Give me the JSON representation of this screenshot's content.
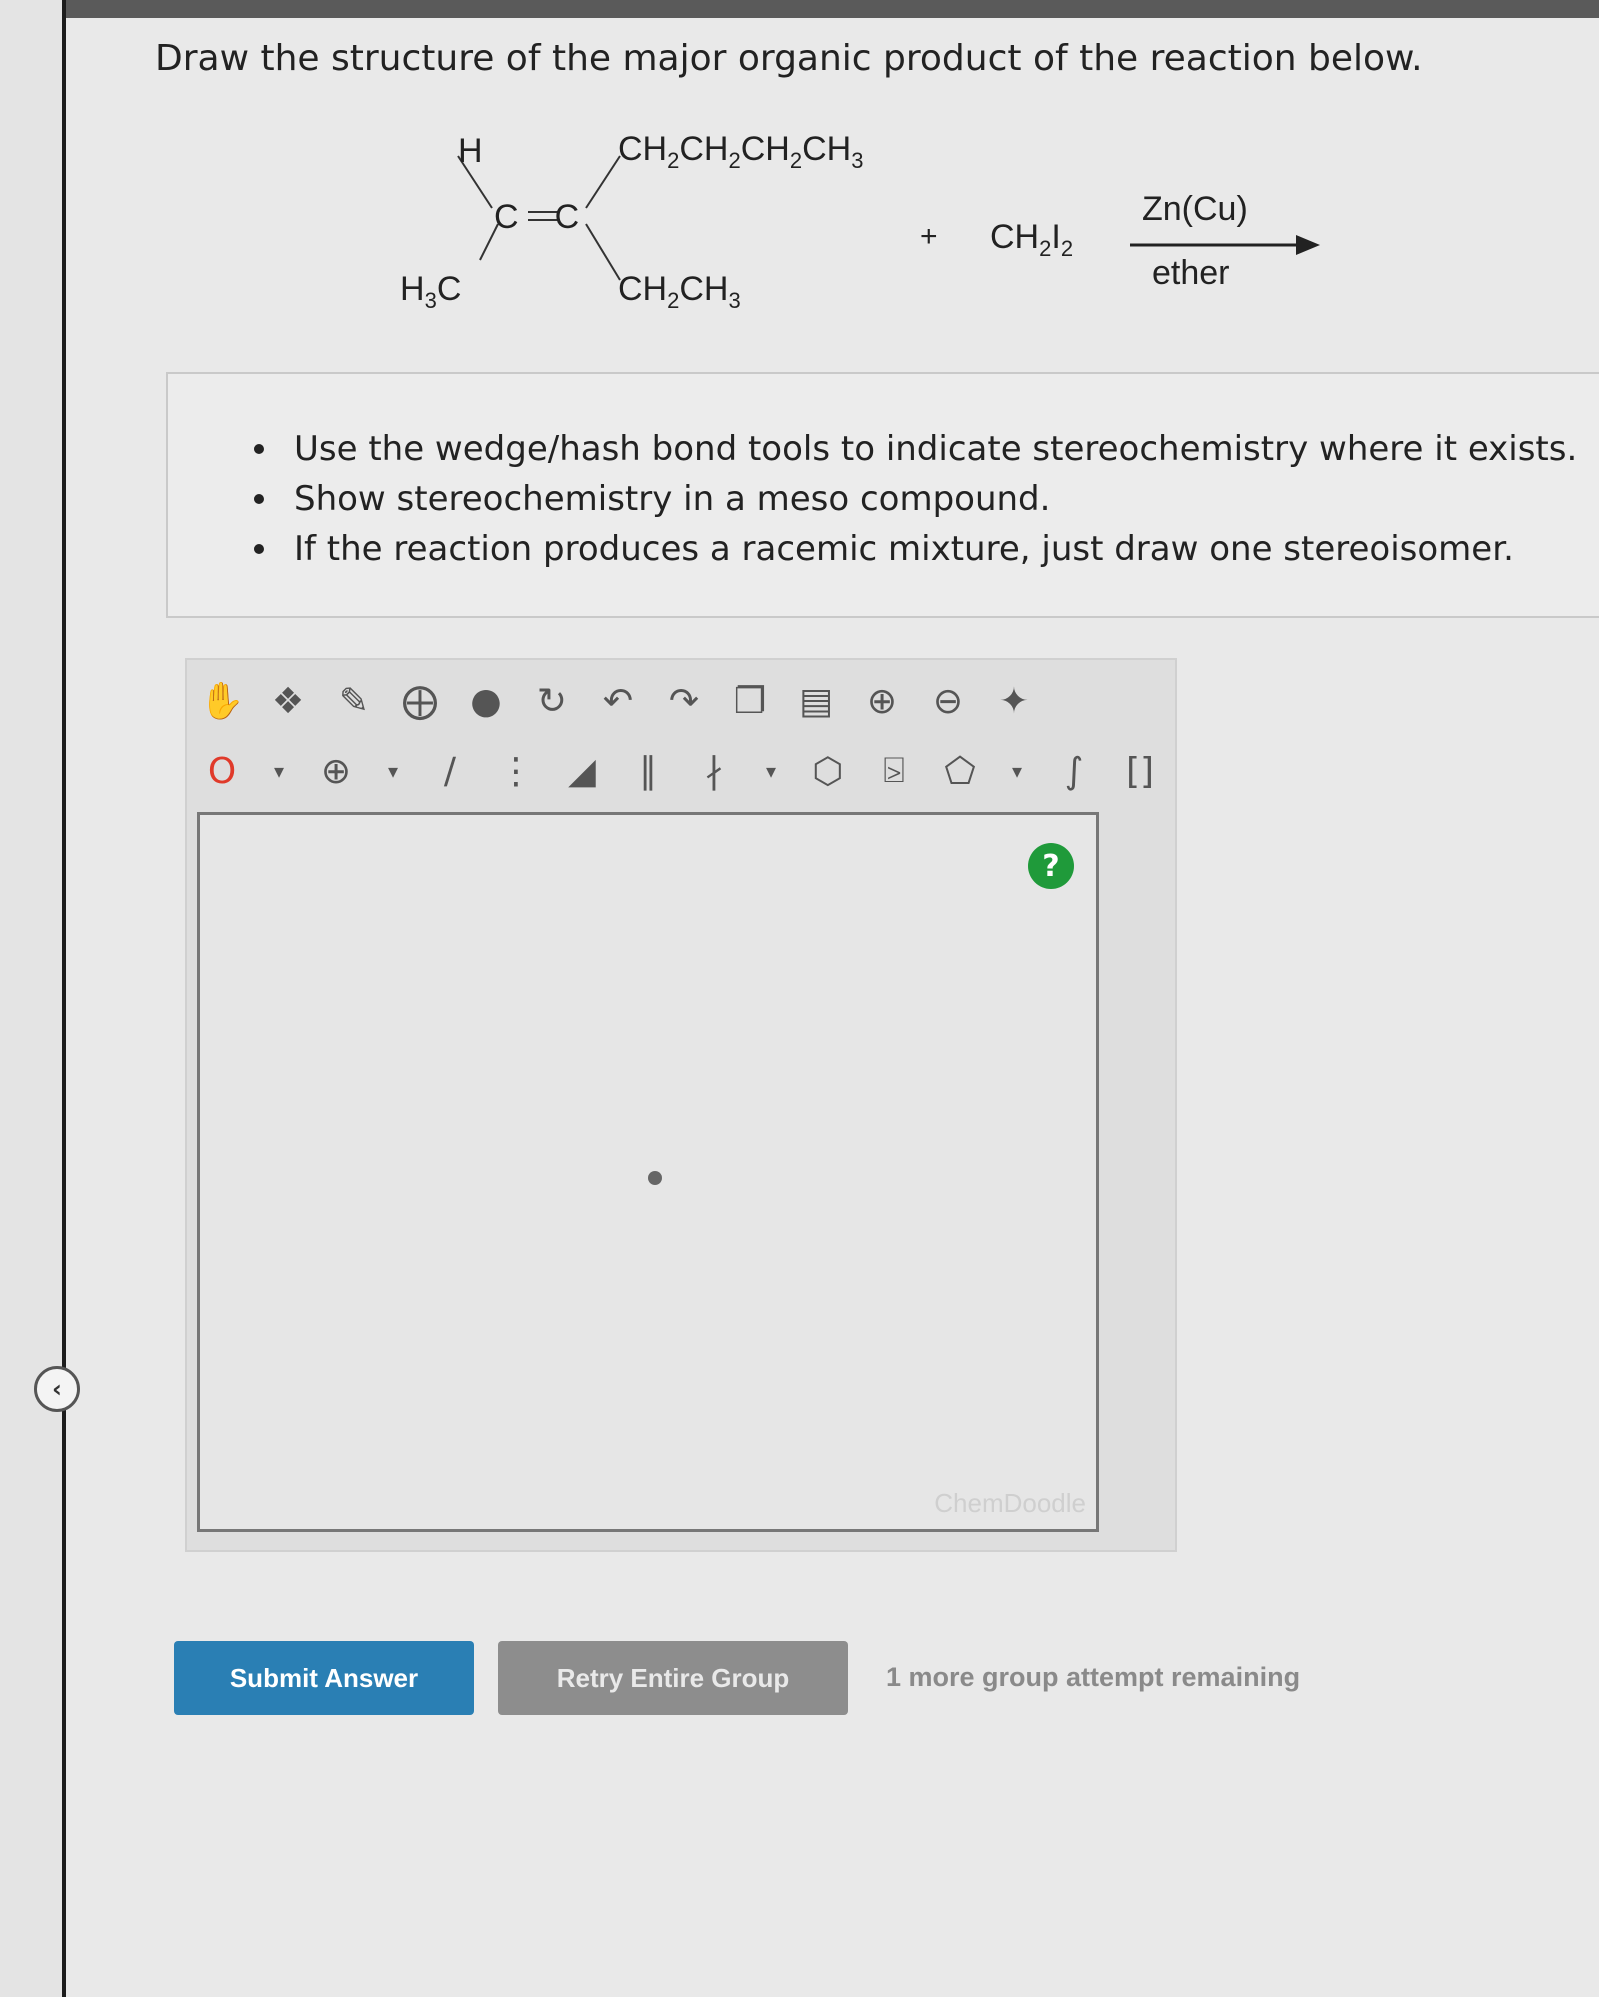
{
  "question": "Draw the structure of the major organic product of the reaction below.",
  "reaction": {
    "top_left": "H",
    "bottom_left_main": "H",
    "bottom_left_sub": "3",
    "bottom_left_tail": "C",
    "center": "C=C",
    "top_right": "CH2CH2CH2CH3",
    "bottom_right": "CH2CH3",
    "plus": "+",
    "reagent": "CH2I2",
    "above_arrow": "Zn(Cu)",
    "below_arrow": "ether"
  },
  "instructions": [
    "Use the wedge/hash bond tools to indicate stereochemistry where it exists.",
    "Show stereochemistry in a meso compound.",
    "If the reaction produces a racemic mixture, just draw one stereoisomer."
  ],
  "editor": {
    "atom_label": "O",
    "help_label": "?",
    "watermark": "ChemDoodle",
    "toolbar_icons": [
      "hand-icon",
      "lasso-icon",
      "eraser-icon",
      "ring-icon",
      "templates-icon",
      "rotate-icon",
      "undo-icon",
      "redo-icon",
      "copy-icon",
      "paste-icon",
      "zoom-in-icon",
      "zoom-out-icon",
      "clean-icon"
    ]
  },
  "buttons": {
    "submit": "Submit Answer",
    "retry": "Retry Entire Group"
  },
  "attempts_text": "1 more group attempt remaining",
  "colors": {
    "submit_bg": "#2a7fb4",
    "retry_bg": "#8d8d8d",
    "help_bg": "#1f9a3a"
  }
}
